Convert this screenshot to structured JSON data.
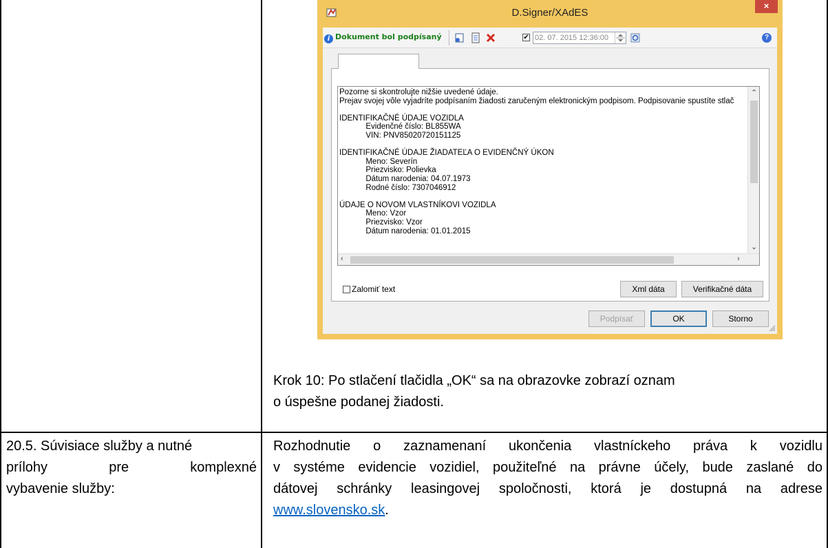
{
  "dialog": {
    "title": "D.Signer/XAdES",
    "close_glyph": "×",
    "status": "Dokument bol podpísaný",
    "info_glyph": "i",
    "help_glyph": "?",
    "checkbox_mark": "✔",
    "datetime": "02. 07. 2015 12:36:00",
    "content_lines": [
      "Pozorne si skontrolujte nižšie uvedené údaje.",
      "Prejav svojej vôle vyjadríte podpísaním žiadosti zaručeným elektronickým podpisom. Podpisovanie spustíte stlač",
      "",
      "IDENTIFIKAČNÉ ÚDAJE VOZIDLA",
      "            Evidenčné číslo: BL855WA",
      "            VIN: PNV85020720151125",
      "",
      "IDENTIFIKAČNÉ ÚDAJE ŽIADATEĽA O EVIDENČNÝ ÚKON",
      "            Meno: Severín",
      "            Priezvisko: Polievka",
      "            Dátum narodenia: 04.07.1973",
      "            Rodné číslo: 7307046912",
      "",
      "ÚDAJE O NOVOM VLASTNÍKOVI VOZIDLA",
      "            Meno: Vzor",
      "            Priezvisko: Vzor",
      "            Dátum narodenia: 01.01.2015"
    ],
    "wrap_label": "Zalomiť text",
    "btn_xml": "Xml dáta",
    "btn_verify": "Verifikačné dáta",
    "btn_sign": "Podpísať",
    "btn_ok": "OK",
    "btn_cancel": "Storno"
  },
  "step": {
    "line1": "Krok 10: Po stlačení tlačidla „OK“ sa na obrazovke zobrazí oznam",
    "line2": "o úspešne podanej žiadosti."
  },
  "section": {
    "label_line1": "20.5. Súvisiace služby a nutné",
    "label_line2_word1": "prílohy",
    "label_line2_word2": "pre",
    "label_line2_word3": "komplexné",
    "label_line3": "vybavenie služby:",
    "text_line1": "Rozhodnutie o zaznamenaní ukončenia vlastníckeho práva k vozidlu",
    "text_line2": "v systéme evidencie vozidiel, použiteľné na právne účely,  bude zaslané do",
    "text_line3": "dátovej schránky leasingovej spoločnosti, ktorá je dostupná na adrese",
    "link": "www.slovensko.sk",
    "link_suffix": "."
  }
}
